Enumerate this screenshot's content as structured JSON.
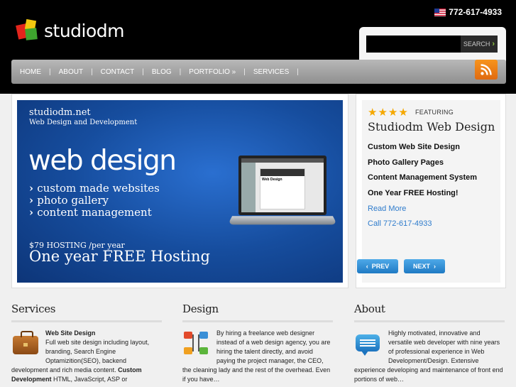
{
  "header": {
    "logo_text": "studiodm",
    "phone": "772-617-4933"
  },
  "search": {
    "value": "",
    "button_label": "SEARCH"
  },
  "nav": {
    "items": [
      {
        "label": "HOME"
      },
      {
        "label": "ABOUT"
      },
      {
        "label": "CONTACT"
      },
      {
        "label": "BLOG"
      },
      {
        "label": "PORTFOLIO »"
      },
      {
        "label": "SERVICES"
      }
    ],
    "separator": "|"
  },
  "banner": {
    "site": "studiodm.net",
    "tagline": "Web Design and Development",
    "heading": "web design",
    "list": [
      "custom made websites",
      "photo gallery",
      "content management"
    ],
    "hosting_small": "$79 HOSTING /per year",
    "hosting_big": "One year FREE Hosting",
    "screen_title": "Web Design"
  },
  "featuring": {
    "stars": "★★★★",
    "label": "FEATURING",
    "title": "Studiodm Web Design",
    "items": [
      "Custom Web Site Design",
      "Photo Gallery Pages",
      "Content Management System",
      "One Year FREE Hosting!"
    ],
    "read_more": "Read More",
    "call": "Call 772-617-4933",
    "prev_label": "PREV",
    "next_label": "NEXT",
    "prev_arrow": "‹",
    "next_arrow": "›"
  },
  "columns": {
    "services": {
      "title": "Services",
      "bold_title": "Web Site Design",
      "text1": "Full web site design including layout, branding, Search Engine Optamizition(SEO), backend development and rich media content.",
      "bold2": "Custom Development",
      "text2": "HTML, JavaScript, ASP or"
    },
    "design": {
      "title": "Design",
      "text": "By hiring a freelance web designer instead of a web design agency, you are hiring the talent directly, and avoid paying the project manager, the CEO, the cleaning lady and the rest of the overhead. Even if you have…"
    },
    "about": {
      "title": "About",
      "text": "Highly motivated, innovative and versatile web developer with nine years of professional experience in Web Development/Design. Extensive experience developing and maintenance of front end portions of web…"
    }
  },
  "colors": {
    "accent_blue": "#2f7ccc",
    "star_color": "#f5a800",
    "rss_orange": "#f7941d",
    "search_arrow": "#8dc63f"
  }
}
